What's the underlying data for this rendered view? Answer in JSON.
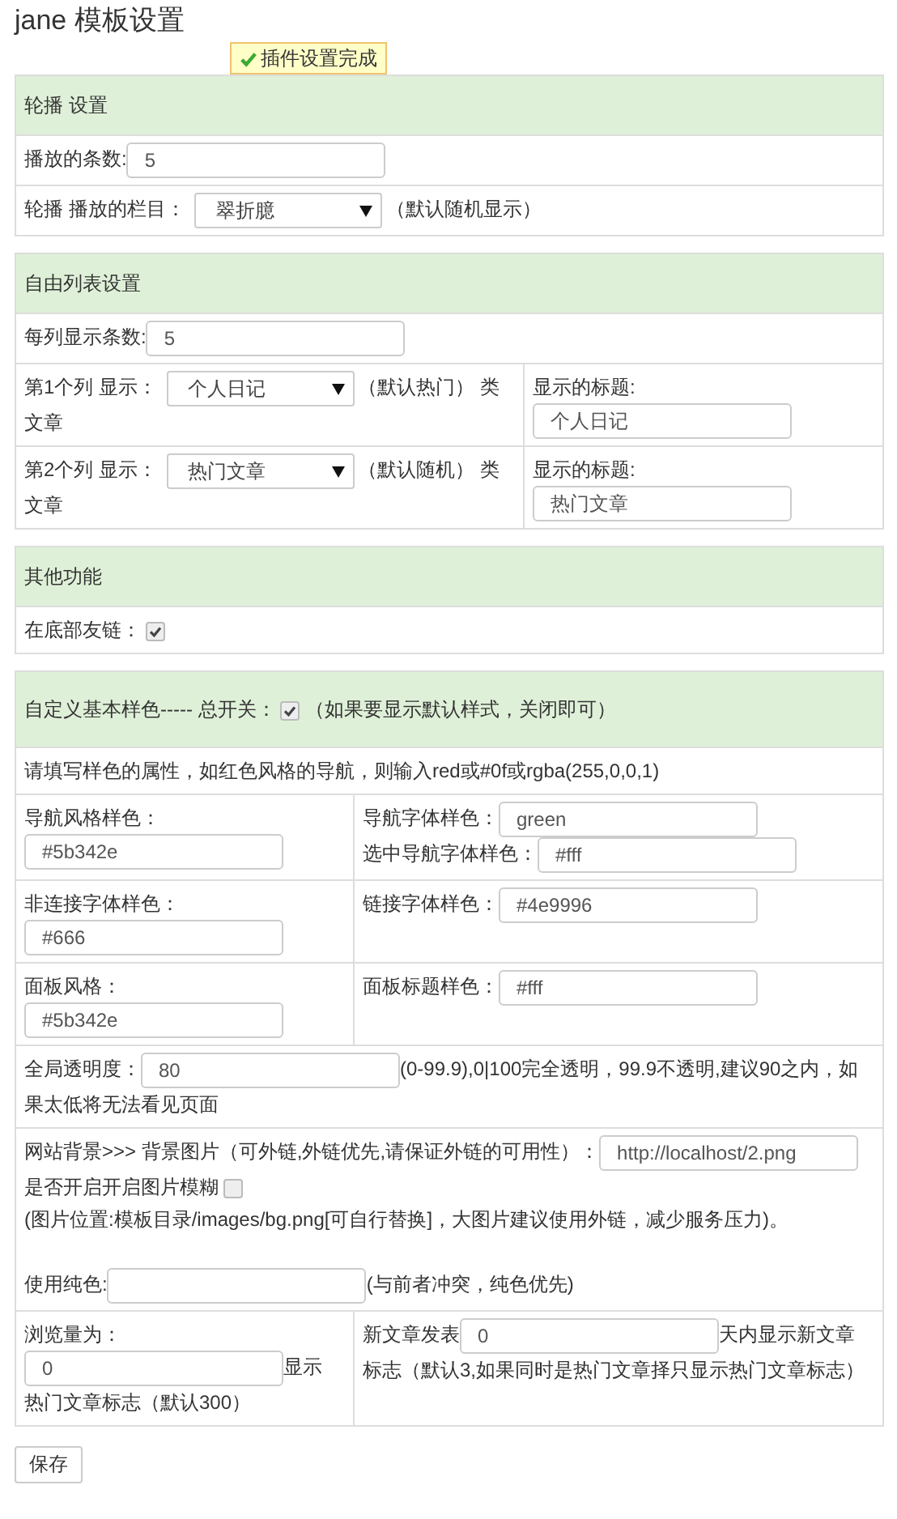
{
  "title": "jane 模板设置",
  "notice": "插件设置完成",
  "panels": [
    {
      "heading": [
        {
          "kind": "text",
          "text": "轮播 设置"
        }
      ],
      "rows": [
        {
          "cells": [
            {
              "items": [
                {
                  "kind": "text",
                  "text": "播放的条数:"
                },
                {
                  "kind": "input",
                  "value": "5"
                }
              ]
            }
          ]
        },
        {
          "cells": [
            {
              "items": [
                {
                  "kind": "text",
                  "text": "轮播 播放的栏目："
                },
                {
                  "kind": "select",
                  "value": "翠折臆"
                },
                {
                  "kind": "text",
                  "text": "（默认随机显示）"
                }
              ]
            }
          ]
        }
      ]
    },
    {
      "heading": [
        {
          "kind": "text",
          "text": "自由列表设置"
        }
      ],
      "rows": [
        {
          "cells": [
            {
              "items": [
                {
                  "kind": "text",
                  "text": "每列显示条数:"
                },
                {
                  "kind": "input",
                  "value": "5"
                }
              ]
            }
          ]
        },
        {
          "cells": [
            {
              "items": [
                {
                  "kind": "text",
                  "text": "第1个列 显示："
                },
                {
                  "kind": "select",
                  "value": "个人日记"
                },
                {
                  "kind": "text",
                  "text": "（默认热门） 类"
                },
                {
                  "kind": "break"
                },
                {
                  "kind": "text",
                  "text": "文章"
                }
              ]
            },
            {
              "items": [
                {
                  "kind": "text",
                  "text": "显示的标题:"
                },
                {
                  "kind": "break"
                },
                {
                  "kind": "input",
                  "value": "个人日记"
                }
              ]
            }
          ]
        },
        {
          "cells": [
            {
              "items": [
                {
                  "kind": "text",
                  "text": "第2个列 显示："
                },
                {
                  "kind": "select",
                  "value": "热门文章"
                },
                {
                  "kind": "text",
                  "text": "（默认随机） 类"
                },
                {
                  "kind": "break"
                },
                {
                  "kind": "text",
                  "text": "文章"
                }
              ]
            },
            {
              "items": [
                {
                  "kind": "text",
                  "text": "显示的标题:"
                },
                {
                  "kind": "break"
                },
                {
                  "kind": "input",
                  "value": "热门文章"
                }
              ]
            }
          ]
        }
      ]
    },
    {
      "heading": [
        {
          "kind": "text",
          "text": "其他功能"
        }
      ],
      "rows": [
        {
          "cells": [
            {
              "items": [
                {
                  "kind": "text",
                  "text": "在底部友链："
                },
                {
                  "kind": "checkbox",
                  "checked": true
                }
              ]
            }
          ]
        }
      ]
    },
    {
      "heading": [
        {
          "kind": "text",
          "text": "自定义基本样色----- 总开关："
        },
        {
          "kind": "checkbox",
          "checked": true
        },
        {
          "kind": "text",
          "text": "（如果要显示默认样式，关闭即可）"
        }
      ],
      "rows": [
        {
          "cells": [
            {
              "items": [
                {
                  "kind": "text",
                  "text": "请填写样色的属性，如红色风格的导航，则输入red或#0f或rgba(255,0,0,1)"
                }
              ]
            }
          ]
        },
        {
          "cells": [
            {
              "items": [
                {
                  "kind": "text",
                  "text": "导航风格样色："
                },
                {
                  "kind": "break"
                },
                {
                  "kind": "input",
                  "value": "#5b342e"
                }
              ]
            },
            {
              "items": [
                {
                  "kind": "text",
                  "text": "导航字体样色："
                },
                {
                  "kind": "input",
                  "value": "green"
                },
                {
                  "kind": "break"
                },
                {
                  "kind": "text",
                  "text": "选中导航字体样色："
                },
                {
                  "kind": "input",
                  "value": "#fff"
                }
              ]
            }
          ]
        },
        {
          "cells": [
            {
              "items": [
                {
                  "kind": "text",
                  "text": "非连接字体样色："
                },
                {
                  "kind": "break"
                },
                {
                  "kind": "input",
                  "value": "#666"
                }
              ]
            },
            {
              "items": [
                {
                  "kind": "text",
                  "text": "链接字体样色："
                },
                {
                  "kind": "input",
                  "value": "#4e9996"
                }
              ]
            }
          ]
        },
        {
          "cells": [
            {
              "items": [
                {
                  "kind": "text",
                  "text": "面板风格："
                },
                {
                  "kind": "break"
                },
                {
                  "kind": "input",
                  "value": "#5b342e"
                }
              ]
            },
            {
              "items": [
                {
                  "kind": "text",
                  "text": "面板标题样色："
                },
                {
                  "kind": "input",
                  "value": "#fff"
                }
              ]
            }
          ]
        },
        {
          "cells": [
            {
              "items": [
                {
                  "kind": "text",
                  "text": "全局透明度："
                },
                {
                  "kind": "input",
                  "value": "80"
                },
                {
                  "kind": "text",
                  "text": "(0-99.9),0|100完全透明，99.9不透明,建议90之内，如"
                },
                {
                  "kind": "break"
                },
                {
                  "kind": "text",
                  "text": "果太低将无法看见页面"
                }
              ]
            }
          ]
        },
        {
          "cells": [
            {
              "items": [
                {
                  "kind": "text",
                  "text": "网站背景>>> 背景图片（可外链,外链优先,请保证外链的可用性）："
                },
                {
                  "kind": "input",
                  "value": "http://localhost/2.png"
                },
                {
                  "kind": "break"
                },
                {
                  "kind": "text",
                  "text": "是否开启开启图片模糊"
                },
                {
                  "kind": "checkbox",
                  "checked": false
                },
                {
                  "kind": "break"
                },
                {
                  "kind": "text",
                  "text": "(图片位置:模板目录/images/bg.png[可自行替换]，大图片建议使用外链，减少服务压力)。"
                },
                {
                  "kind": "break"
                },
                {
                  "kind": "break"
                },
                {
                  "kind": "text",
                  "text": "使用纯色:"
                },
                {
                  "kind": "input",
                  "value": ""
                },
                {
                  "kind": "text",
                  "text": "(与前者冲突，纯色优先)"
                }
              ]
            }
          ]
        },
        {
          "cells": [
            {
              "items": [
                {
                  "kind": "text",
                  "text": "浏览量为："
                },
                {
                  "kind": "break"
                },
                {
                  "kind": "input",
                  "value": "0"
                },
                {
                  "kind": "text",
                  "text": "显示"
                },
                {
                  "kind": "break"
                },
                {
                  "kind": "text",
                  "text": "热门文章标志（默认300）"
                }
              ]
            },
            {
              "items": [
                {
                  "kind": "text",
                  "text": "新文章发表"
                },
                {
                  "kind": "input",
                  "value": "0"
                },
                {
                  "kind": "text",
                  "text": "天内显示新文章"
                },
                {
                  "kind": "break"
                },
                {
                  "kind": "text",
                  "text": "标志（默认3,如果同时是热门文章择只显示热门文章标志）"
                }
              ]
            }
          ]
        }
      ]
    }
  ],
  "save_button": "保存"
}
